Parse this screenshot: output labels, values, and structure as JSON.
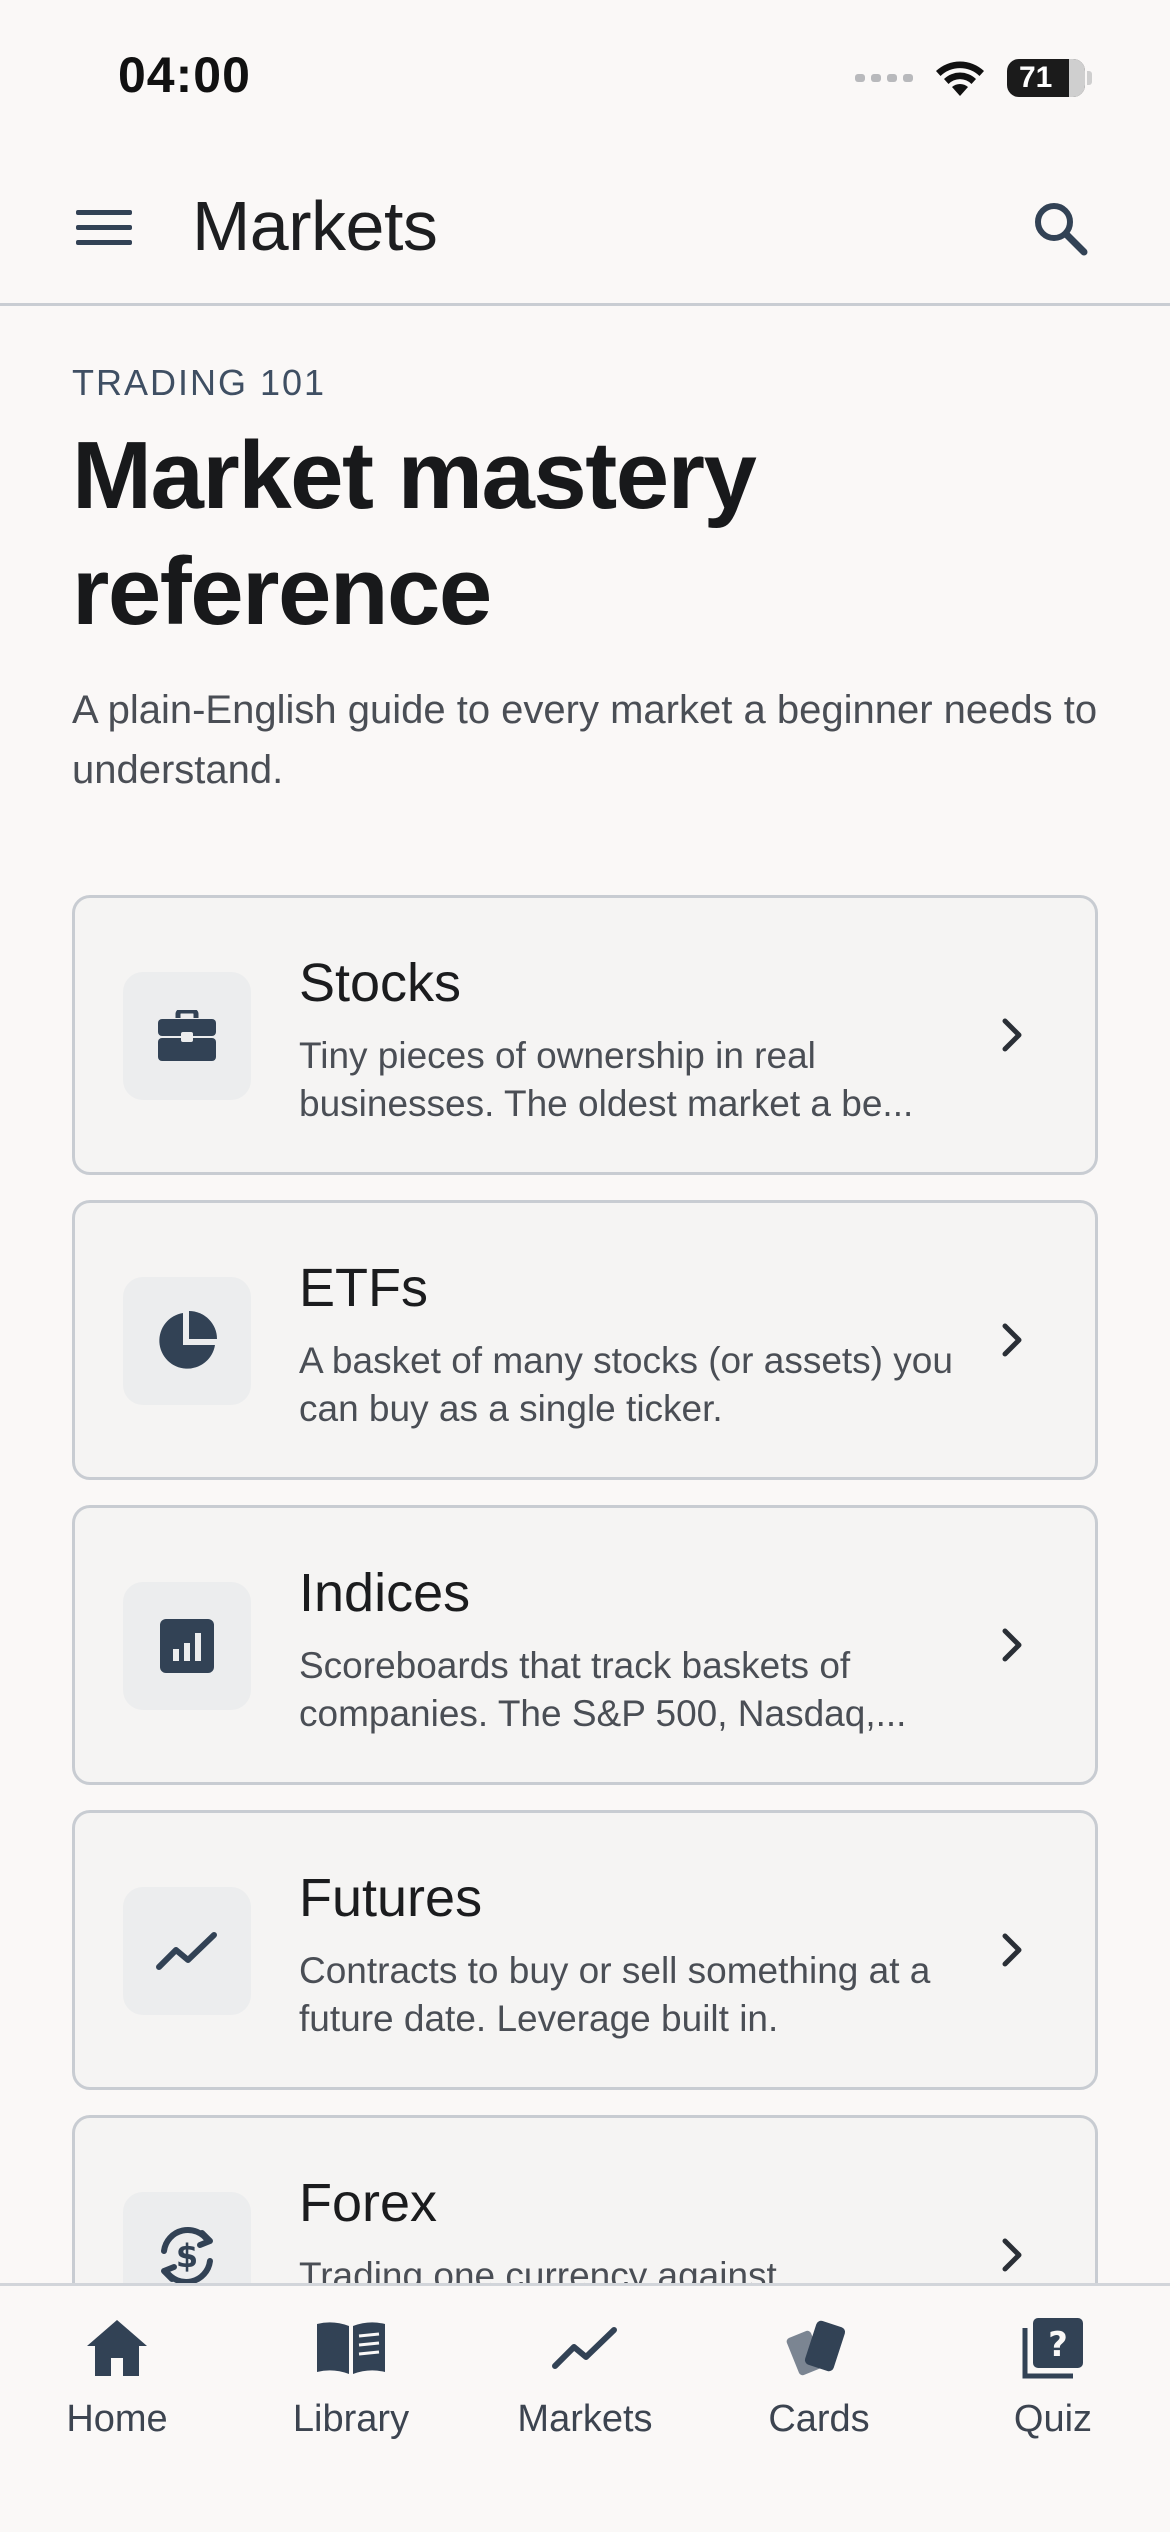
{
  "status_bar": {
    "time": "04:00",
    "battery": "71"
  },
  "app_bar": {
    "title": "Markets"
  },
  "hero": {
    "eyebrow": "TRADING 101",
    "title": "Market mastery reference",
    "subtitle": "A plain-English guide to every market a beginner needs to understand."
  },
  "cards": [
    {
      "title": "Stocks",
      "description": "Tiny pieces of ownership in real businesses. The oldest market a be...",
      "icon": "briefcase-icon"
    },
    {
      "title": "ETFs",
      "description": "A basket of many stocks (or assets) you can buy as a single ticker.",
      "icon": "pie-chart-icon"
    },
    {
      "title": "Indices",
      "description": "Scoreboards that track baskets of companies. The S&P 500, Nasdaq,...",
      "icon": "bar-chart-icon"
    },
    {
      "title": "Futures",
      "description": "Contracts to buy or sell something at a future date. Leverage built in.",
      "icon": "trend-line-icon"
    },
    {
      "title": "Forex",
      "description": "Trading one currency against",
      "icon": "currency-exchange-icon"
    }
  ],
  "bottom_nav": [
    {
      "label": "Home",
      "icon": "home-icon"
    },
    {
      "label": "Library",
      "icon": "book-icon"
    },
    {
      "label": "Markets",
      "icon": "trend-line-icon"
    },
    {
      "label": "Cards",
      "icon": "cards-icon"
    },
    {
      "label": "Quiz",
      "icon": "quiz-icon"
    }
  ],
  "colors": {
    "icon": "#324255",
    "background": "#faf8f7",
    "card": "#f5f4f3",
    "border": "#c8ccd2"
  }
}
